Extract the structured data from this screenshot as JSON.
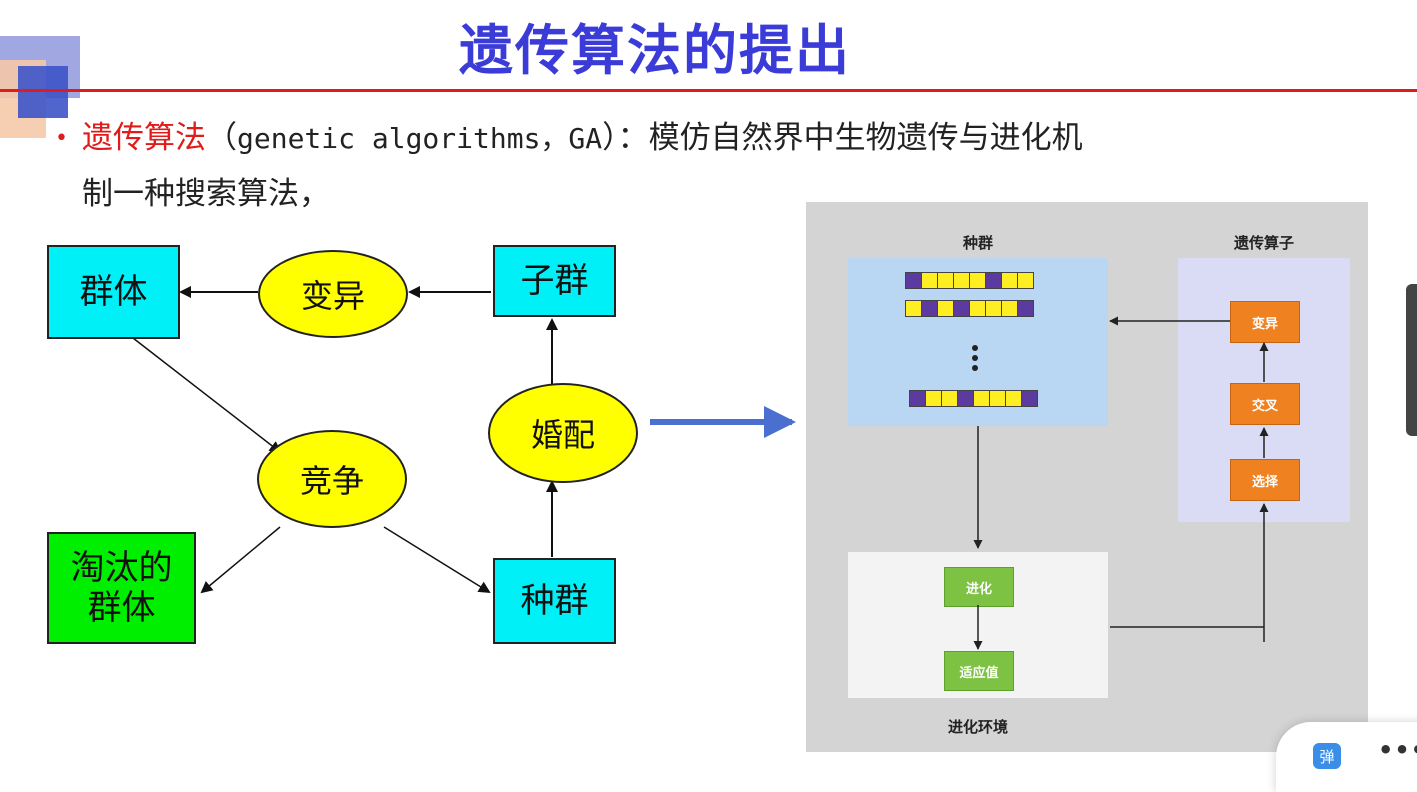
{
  "slide": {
    "title": "遗传算法的提出",
    "intro_red": "遗传算法",
    "intro_paren_open": "（",
    "intro_english": "genetic algorithms，GA",
    "intro_paren_close": "）：",
    "intro_rest": "模仿自然界中生物遗传与进化机",
    "intro_line2": "制一种搜索算法，"
  },
  "left_diagram": {
    "population_top": "群体",
    "mutation": "变异",
    "subgroup": "子群",
    "mating": "婚配",
    "competition": "竞争",
    "eliminated_line1": "淘汰的",
    "eliminated_line2": "群体",
    "species": "种群"
  },
  "right_diagram": {
    "population_label": "种群",
    "operators_label": "遗传算子",
    "mutation": "变异",
    "crossover": "交叉",
    "selection": "选择",
    "evolution": "进化",
    "fitness": "适应值",
    "environment_label": "进化环境",
    "chromosomes": [
      [
        "P",
        "Y",
        "Y",
        "Y",
        "Y",
        "P",
        "Y",
        "Y"
      ],
      [
        "Y",
        "P",
        "Y",
        "P",
        "Y",
        "Y",
        "Y",
        "P"
      ],
      [
        "P",
        "Y",
        "Y",
        "P",
        "Y",
        "Y",
        "Y",
        "P"
      ]
    ]
  },
  "widgets": {
    "danmu_label": "弹",
    "more_label": "•••"
  },
  "colors": {
    "title": "#3b3bd8",
    "accent_red": "#e11a1a",
    "cyan_box": "#00f0f8",
    "green_box": "#00ee00",
    "ellipse": "#ffff00",
    "operator": "#f08120",
    "env_box": "#7dc242",
    "arrow_blue": "#4a6fd0"
  }
}
